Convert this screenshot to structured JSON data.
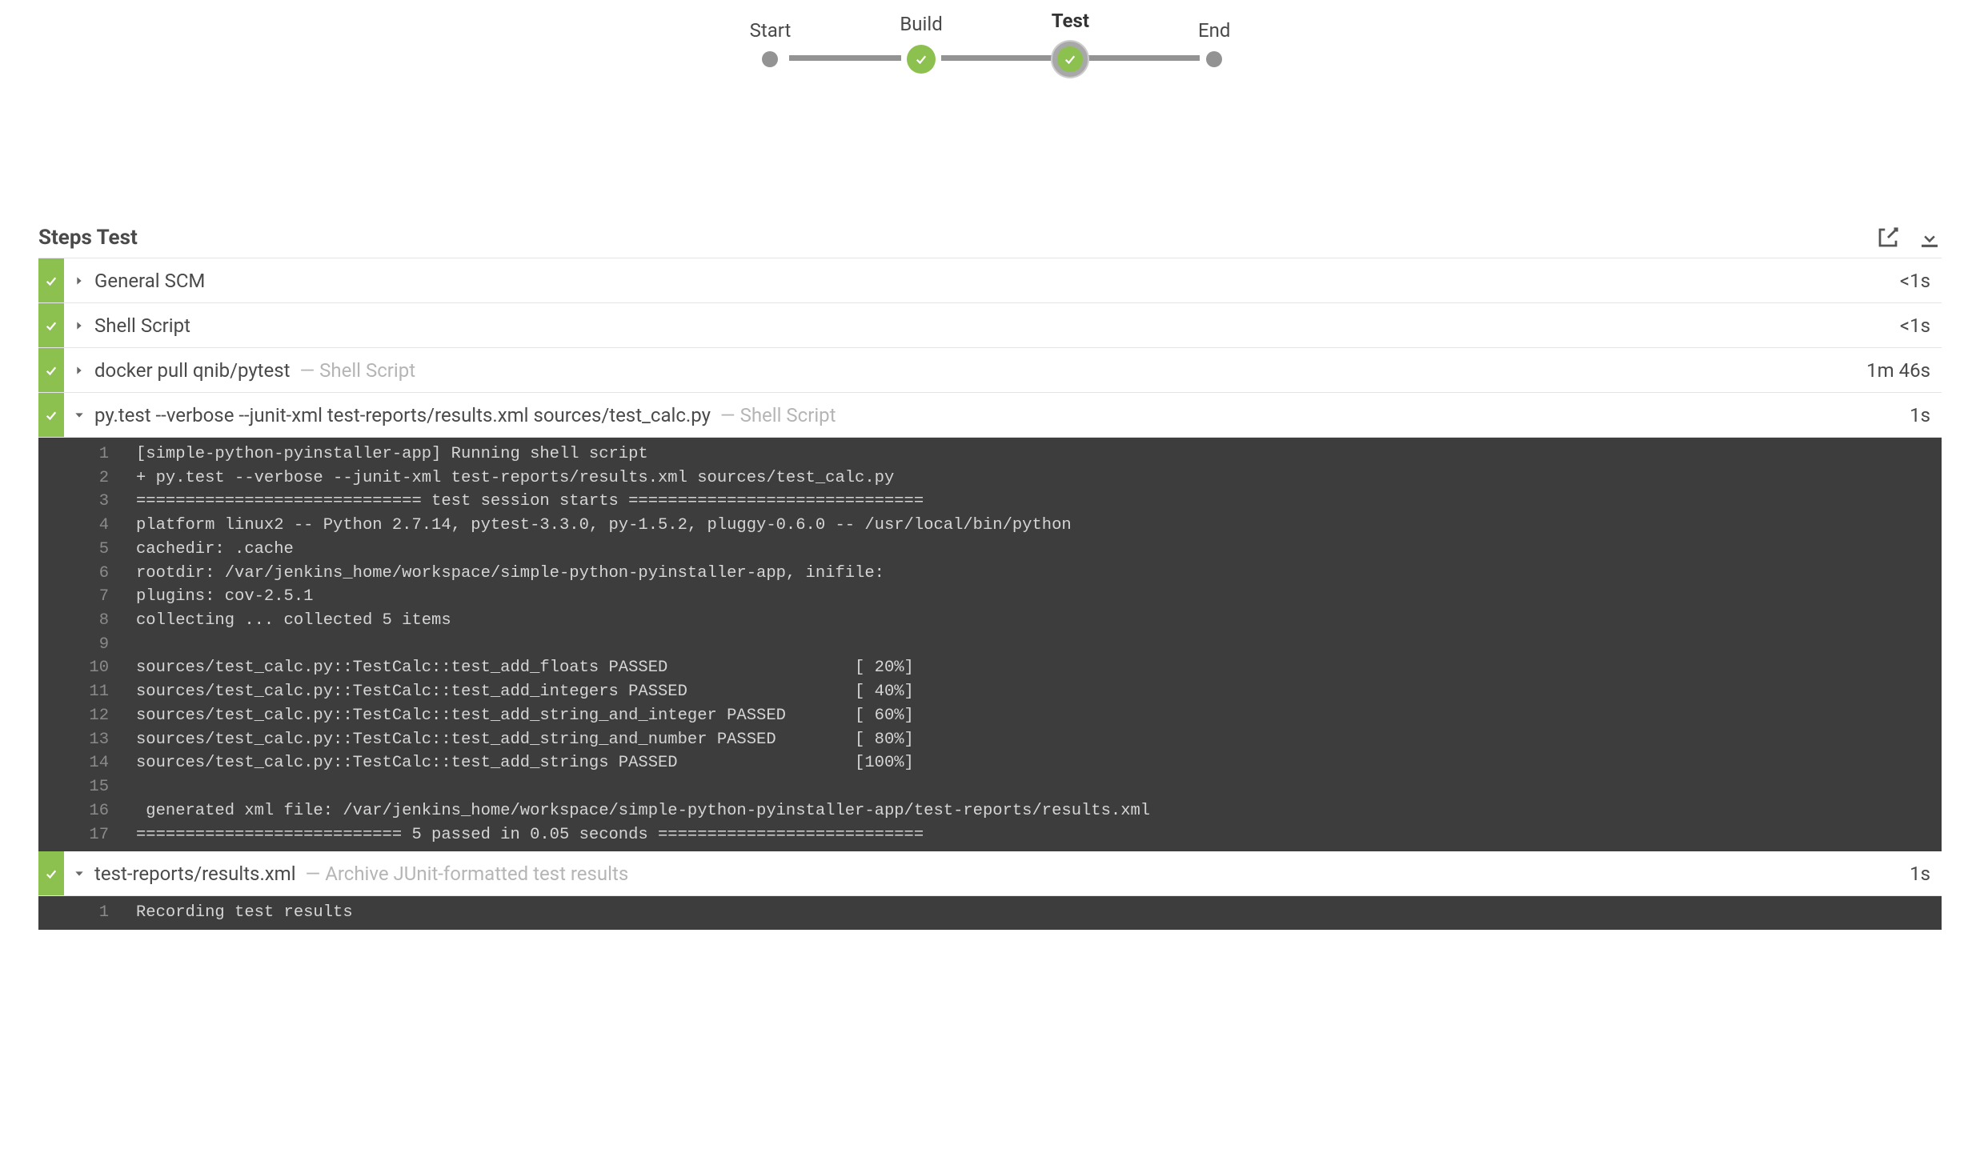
{
  "pipeline": {
    "stages": [
      {
        "label": "Start",
        "state": "dot"
      },
      {
        "label": "Build",
        "state": "success"
      },
      {
        "label": "Test",
        "state": "success-active"
      },
      {
        "label": "End",
        "state": "dot"
      }
    ]
  },
  "steps_header": {
    "title": "Steps Test"
  },
  "steps": [
    {
      "title": "General SCM",
      "subtitle": "",
      "duration": "<1s",
      "expanded": false
    },
    {
      "title": "Shell Script",
      "subtitle": "",
      "duration": "<1s",
      "expanded": false
    },
    {
      "title": "docker pull qnib/pytest",
      "subtitle": "— Shell Script",
      "duration": "1m 46s",
      "expanded": false
    },
    {
      "title": "py.test --verbose --junit-xml test-reports/results.xml sources/test_calc.py",
      "subtitle": "— Shell Script",
      "duration": "1s",
      "expanded": true
    },
    {
      "title": "test-reports/results.xml",
      "subtitle": "— Archive JUnit-formatted test results",
      "duration": "1s",
      "expanded": true
    }
  ],
  "console_step3": [
    "[simple-python-pyinstaller-app] Running shell script",
    "+ py.test --verbose --junit-xml test-reports/results.xml sources/test_calc.py",
    "============================= test session starts ==============================",
    "platform linux2 -- Python 2.7.14, pytest-3.3.0, py-1.5.2, pluggy-0.6.0 -- /usr/local/bin/python",
    "cachedir: .cache",
    "rootdir: /var/jenkins_home/workspace/simple-python-pyinstaller-app, inifile:",
    "plugins: cov-2.5.1",
    "collecting ... collected 5 items",
    "",
    "sources/test_calc.py::TestCalc::test_add_floats PASSED                   [ 20%]",
    "sources/test_calc.py::TestCalc::test_add_integers PASSED                 [ 40%]",
    "sources/test_calc.py::TestCalc::test_add_string_and_integer PASSED       [ 60%]",
    "sources/test_calc.py::TestCalc::test_add_string_and_number PASSED        [ 80%]",
    "sources/test_calc.py::TestCalc::test_add_strings PASSED                  [100%]",
    "",
    " generated xml file: /var/jenkins_home/workspace/simple-python-pyinstaller-app/test-reports/results.xml ",
    "=========================== 5 passed in 0.05 seconds ==========================="
  ],
  "console_step4": [
    "Recording test results"
  ]
}
